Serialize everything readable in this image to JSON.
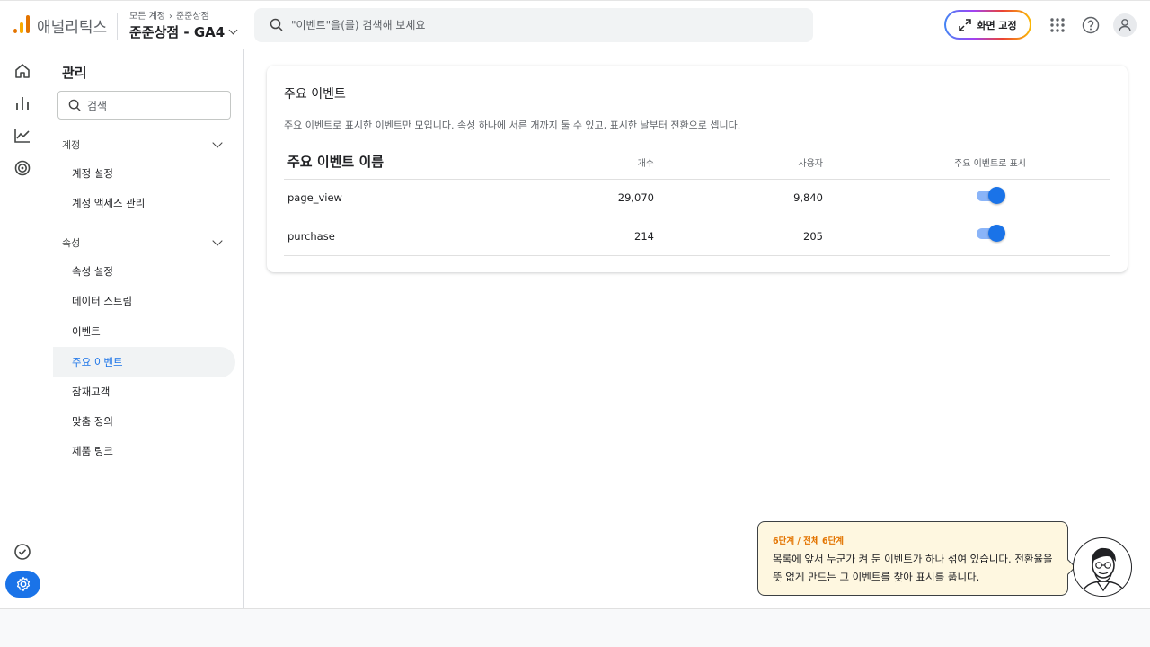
{
  "header": {
    "app_name": "애널리틱스",
    "breadcrumb": [
      "모든 계정",
      "준준상점"
    ],
    "property_name": "준준상점 - GA4",
    "search_placeholder": "\"이벤트\"을(를) 검색해 보세요",
    "pin_label": "화면 고정",
    "logo_colors": [
      "#e37400",
      "#f9ab00"
    ]
  },
  "rail": {
    "icons": [
      "home-icon",
      "reports-icon",
      "explore-icon",
      "advertising-icon",
      "checklist-icon",
      "settings-icon"
    ]
  },
  "sidenav": {
    "title": "관리",
    "search_placeholder": "검색",
    "sections": [
      {
        "label": "계정",
        "items": [
          "계정 설정",
          "계정 액세스 관리"
        ]
      },
      {
        "label": "속성",
        "items": [
          "속성 설정",
          "데이터 스트림",
          "이벤트",
          "주요 이벤트",
          "잠재고객",
          "맞춤 정의",
          "제품 링크"
        ]
      }
    ],
    "active_item": "주요 이벤트"
  },
  "card": {
    "title": "주요 이벤트",
    "description": "주요 이벤트로 표시한 이벤트만 모입니다. 속성 하나에 서른 개까지 둘 수 있고, 표시한 날부터 전환으로 셉니다.",
    "columns": [
      "주요 이벤트 이름",
      "개수",
      "사용자",
      "주요 이벤트로 표시"
    ],
    "rows": [
      {
        "name": "page_view",
        "count": "29,070",
        "users": "9,840",
        "marked": true
      },
      {
        "name": "purchase",
        "count": "214",
        "users": "205",
        "marked": true
      }
    ]
  },
  "tutorial": {
    "step": "6단계 / 전체 6단계",
    "message": "목록에 앞서 누군가 켜 둔 이벤트가 하나 섞여 있습니다. 전환율을 뜻 없게 만드는 그 이벤트를 찾아 표시를 풉니다."
  },
  "colors": {
    "accent": "#1a73e8",
    "toggle_track": "#8ab4f8",
    "tip_bg": "#fef7e0",
    "step_color": "#e37400"
  }
}
